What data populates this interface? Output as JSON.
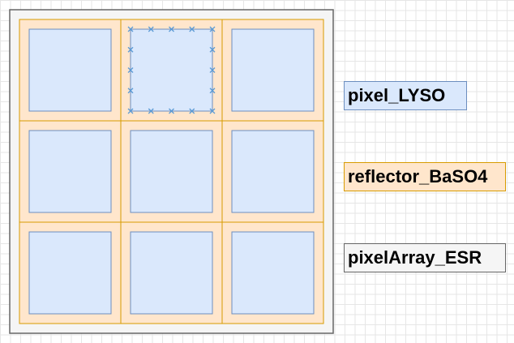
{
  "diagram": {
    "grid_rows": 3,
    "grid_cols": 3,
    "selected_pixel": {
      "row": 0,
      "col": 1
    }
  },
  "legend": [
    {
      "label": "pixel_LYSO",
      "fill": "#dae8fc",
      "stroke": "#6c8ebf"
    },
    {
      "label": "reflector_BaSO4",
      "fill": "#ffe6cc",
      "stroke": "#d79b00"
    },
    {
      "label": "pixelArray_ESR",
      "fill": "#f5f5f5",
      "stroke": "#666666"
    }
  ],
  "colors": {
    "array_fill": "#f5f5f5",
    "array_stroke": "#666666",
    "reflector_fill": "#ffe6cc",
    "reflector_stroke": "#d79b00",
    "pixel_fill": "#dae8fc",
    "pixel_stroke": "#6c8ebf",
    "selection_marker": "#5b9bd5"
  }
}
